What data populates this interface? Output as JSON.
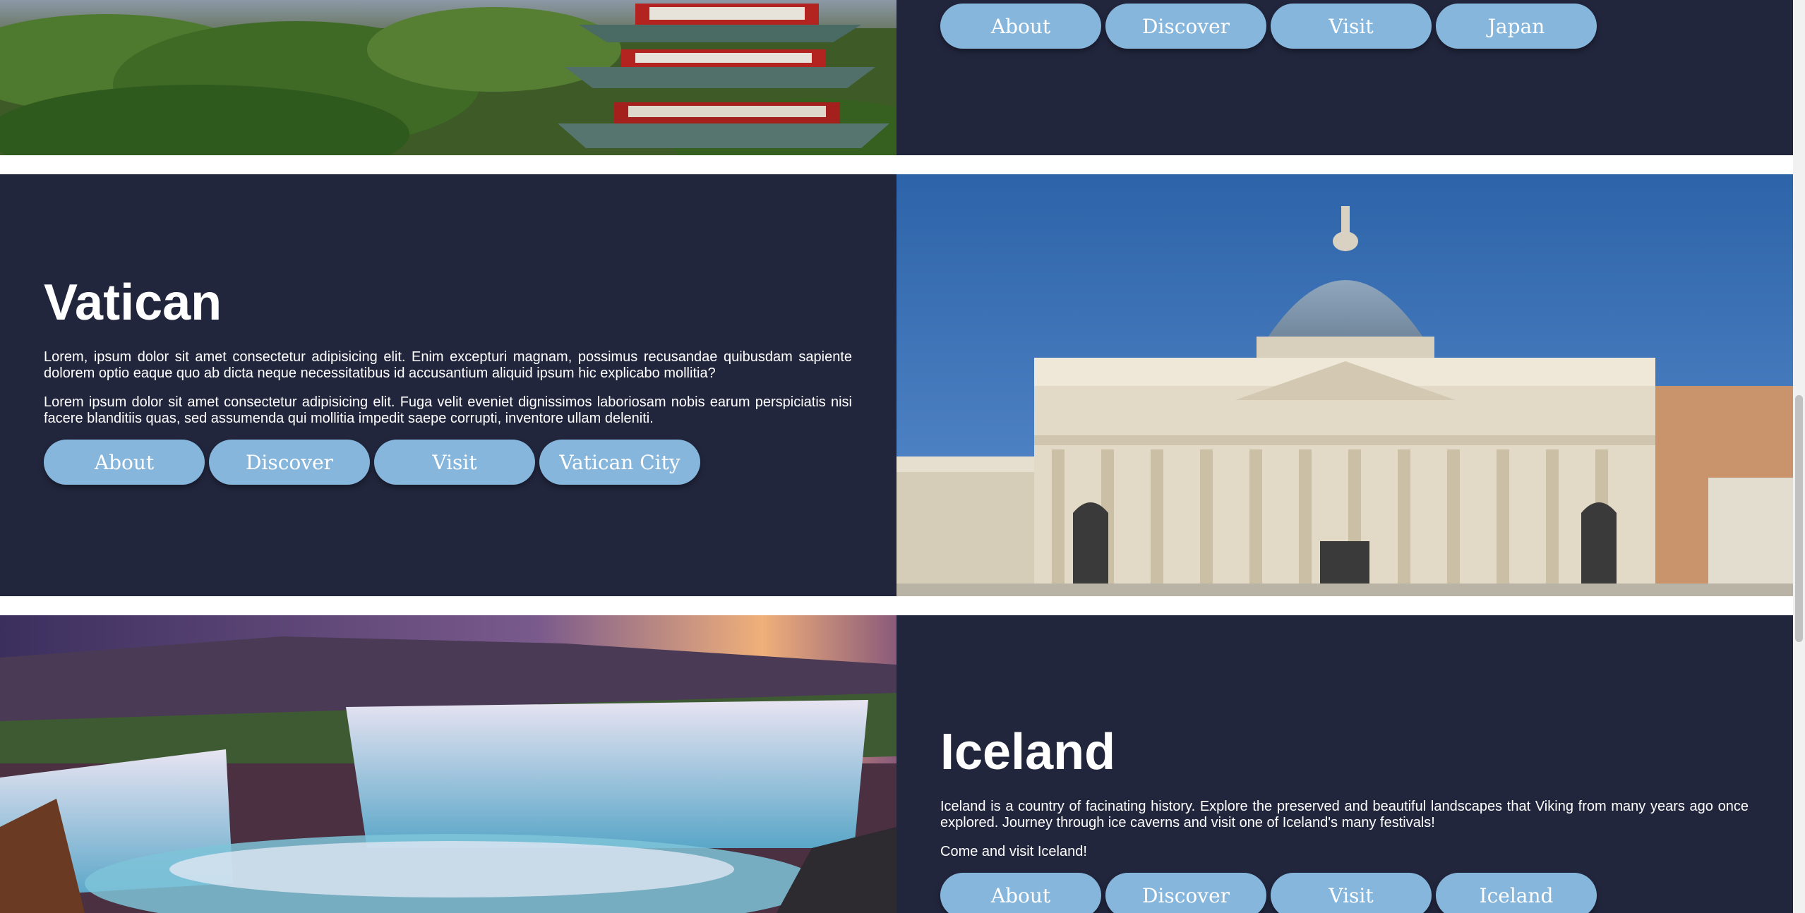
{
  "sections": {
    "japan": {
      "buttons": [
        "About",
        "Discover",
        "Visit",
        "Japan"
      ]
    },
    "vatican": {
      "title": "Vatican",
      "paragraphs": [
        "Lorem, ipsum dolor sit amet consectetur adipisicing elit. Enim excepturi magnam, possimus recusandae quibusdam sapiente dolorem optio eaque quo ab dicta neque necessitatibus id accusantium aliquid ipsum hic explicabo mollitia?",
        "Lorem ipsum dolor sit amet consectetur adipisicing elit. Fuga velit eveniet dignissimos laboriosam nobis earum perspiciatis nisi facere blanditiis quas, sed assumenda qui mollitia impedit saepe corrupti, inventore ullam deleniti."
      ],
      "buttons": [
        "About",
        "Discover",
        "Visit",
        "Vatican City"
      ]
    },
    "iceland": {
      "title": "Iceland",
      "paragraphs": [
        "Iceland is a country of facinating history. Explore the preserved and beautiful landscapes that Viking from many years ago once explored. Journey through ice caverns and visit one of Iceland's many festivals!",
        "Come and visit Iceland!"
      ],
      "buttons": [
        "About",
        "Discover",
        "Visit",
        "Iceland"
      ]
    }
  },
  "colors": {
    "section_bg": "#22263d",
    "button_bg": "#86b6dc",
    "text": "#ffffff"
  }
}
